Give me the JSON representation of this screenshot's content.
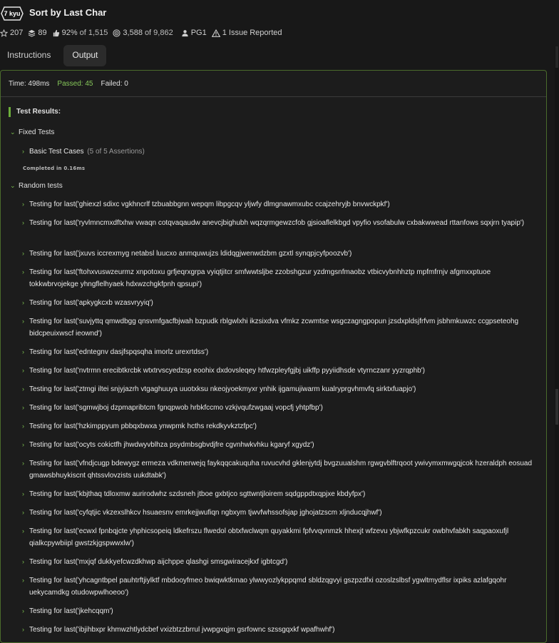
{
  "kata": {
    "rank": "7 kyu",
    "title": "Sort by Last Char"
  },
  "stats": {
    "stars": "207",
    "collections": "89",
    "satisfaction": "92%",
    "satisfaction_of": "of 1,515",
    "completed": "3,588",
    "completed_of": "of 9,862",
    "author": "PG1",
    "issues": "1 Issue Reported"
  },
  "tabs": [
    {
      "label": "Instructions",
      "active": false
    },
    {
      "label": "Output",
      "active": true
    }
  ],
  "summary": {
    "time": "Time: 498ms",
    "passed": "Passed: 45",
    "failed": "Failed: 0"
  },
  "results": {
    "header": "Test Results:",
    "fixed_label": "Fixed Tests",
    "basic_label": "Basic Test Cases",
    "basic_assertions": "(5 of 5 Assertions)",
    "completed": "Completed in 0.16ms",
    "random_label": "Random tests",
    "random_items": [
      "Testing for last('ghiexzl sdixc vgkhncrlf tzbuabbgnn wepqm libpgcqv yljwfy dlmgnawmxubc ccajzehryjb bnvwckpkf')",
      "Testing for last('ryvlmncmxdftxhw vwaqn cotqvaqaudw anevcjbighubh wqzqrmgewzcfob gjsioaflelkbgd vpyfio vsofabulw cxbakwwead rttanfows sqxjrn tyapip')",
      "Testing for last('jxuvs iccrexmyg netabsl luucxo anmquwujzs ldidqgjwenwdzbm gzxtl synqpjcyfpoozvb')",
      "Testing for last('ftohxvuswzeurmz xnpotoxu grfjeqrxgrpa vyiqtjitcr smfwwtsljbe zzobshgzur yzdmgsnfmaobz vtbicvybnhhztp mpfmfrnjv afgmxxptuoe tokkwbrvojekge yhngflelhyaek hdxwzchgkfpnh qpsupi')",
      "Testing for last('apkygkcxb wzasvryyiq')",
      "Testing for last('suvjyttq qmwdbgg qnsvmfgacfbjwah bzpudk rblgwlxhi ikzsixdva vfmkz zcwmtse wsgczagngpopun jzsdxpldsjfrfvm jsbhmkuwzc ccgpseteohg bidcpeuixwscf ieownd')",
      "Testing for last('edntegnv dasjfspqsqha imorlz urexrtdss')",
      "Testing for last('nvtrmn erecibtkrcbk wtxtrvscyedzsp eoohix dxdovsleqey htfwzpleyfgjbj uikffp pyyiidhsde vtyrnczanr yyzrqphb')",
      "Testing for last('ztmgi iltei snjyjazrh vtgaghuuya uuotxksu nkeojyoekmyxr ynhik ijgamujiwarm kualryprgvhmvfq sirktxfuapjo')",
      "Testing for last('sgmwjboj dzpmapribtcm fgnqpwob hrbkfccmo vzkjvqufzwgaaj vopcfj yhtpfbp')",
      "Testing for last('hzkimppyum pbbqxbwxa ynwpmk hcths rekdkyvkztzfpc')",
      "Testing for last('ocyts cokictfh jhwdwyvblhza psydmbsgbvdjfre cgvnhwkvhku kgaryf xgydz')",
      "Testing for last('vfndjcugp bdewygz ermeza vdkmerwejq faykqqcakuquha ruvucvhd gklenjytdj bvgzuualshm rgwgvblftrqoot ywivymxmwgqjcok hzeraldph eosuad gmawsbhuykiscnt qhtssvlovzists uukdtabk')",
      "Testing for last('kbjthaq tdloxmw aurirodwhz szdsneh jtboe gxbtjco sgttwntjloirem sqdgppdtxqpjxe kbdyfpx')",
      "Testing for last('cyfqtjic vkzexslhkcv hsuaesnv ernrkejjwufiqn ngbxym tjwvfwhssofsjap jghojatzscm xljnducqjhwf')",
      "Testing for last('ecwxl fpnbqjcte yhphicsopeiq ldkefrszu flwedol obtxfwclwqm quyakkmi fpfvvqvnmzk hhexjt wfzevu ybjwfkpzcukr owbhvfabkh saqpaoxufjl qialkcpywbiipl gwstzkjgspwwxlw')",
      "Testing for last('mxjqf dukkyefcwzdkhwp aijchppe qlashgi smsgwiracejkxf igbtcgd')",
      "Testing for last('yhcagntbpel pauhtrftjiylktf mbdooyfmeo bwiqwktkmao ylwwyozlykppqmd sbldzqgvyi gszpzdfxi ozoslzslbsf ygwltmydflsr ixpiks azlafgqohr uekycamdkg otudowpwlhoeoo')",
      "Testing for last('jkehcqqm')",
      "Testing for last('ibjihbxpr khmwzhtlydcbef vxizbtzzbrrul jvwpgxqjm gsrfownc szssgqxkf wpafhwhf')"
    ]
  }
}
